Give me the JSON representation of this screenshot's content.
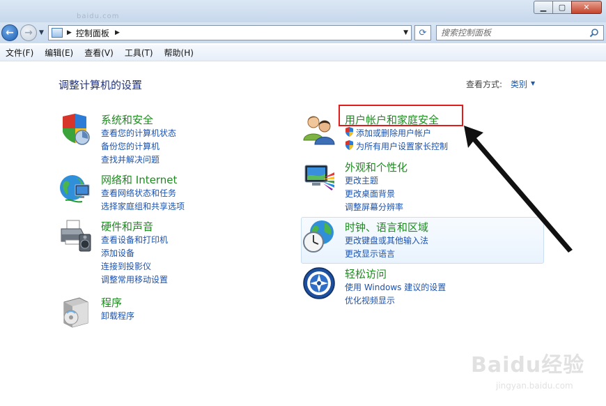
{
  "window": {
    "faint_title": "baidu.com",
    "buttons": {
      "minimize": "▁",
      "maximize": "▢",
      "close": "✕"
    }
  },
  "nav": {
    "back_glyph": "←",
    "forward_glyph": "→",
    "dropdown_glyph": "▼"
  },
  "address": {
    "separator": "▶",
    "path": "控制面板",
    "trailing_separator": "▶",
    "dropdown_glyph": "▼",
    "refresh_glyph": "⟳"
  },
  "search": {
    "placeholder": "搜索控制面板"
  },
  "menu": [
    "文件(F)",
    "编辑(E)",
    "查看(V)",
    "工具(T)",
    "帮助(H)"
  ],
  "content": {
    "title": "调整计算机的设置",
    "view_by_label": "查看方式:",
    "view_by_value": "类别",
    "view_by_arrow": "▼"
  },
  "categories": {
    "system": {
      "title": "系统和安全",
      "links": [
        "查看您的计算机状态",
        "备份您的计算机",
        "查找并解决问题"
      ]
    },
    "network": {
      "title": "网络和 Internet",
      "links": [
        "查看网络状态和任务",
        "选择家庭组和共享选项"
      ]
    },
    "hardware": {
      "title": "硬件和声音",
      "links": [
        "查看设备和打印机",
        "添加设备",
        "连接到投影仪",
        "调整常用移动设置"
      ]
    },
    "programs": {
      "title": "程序",
      "links": [
        "卸载程序"
      ]
    },
    "users": {
      "title": "用户帐户和家庭安全",
      "links": [
        "添加或删除用户帐户",
        "为所有用户设置家长控制"
      ]
    },
    "appearance": {
      "title": "外观和个性化",
      "links": [
        "更改主题",
        "更改桌面背景",
        "调整屏幕分辨率"
      ]
    },
    "clock": {
      "title": "时钟、语言和区域",
      "links": [
        "更改键盘或其他输入法",
        "更改显示语言"
      ]
    },
    "ease": {
      "title": "轻松访问",
      "links": [
        "使用 Windows 建议的设置",
        "优化视频显示"
      ]
    }
  },
  "watermark": {
    "brand": "Baidu经验",
    "url": "jingyan.baidu.com"
  },
  "colors": {
    "category_title": "#1e8a20",
    "link": "#1d52ad",
    "highlight": "#e21b1b",
    "title_blue": "#1e3287"
  }
}
